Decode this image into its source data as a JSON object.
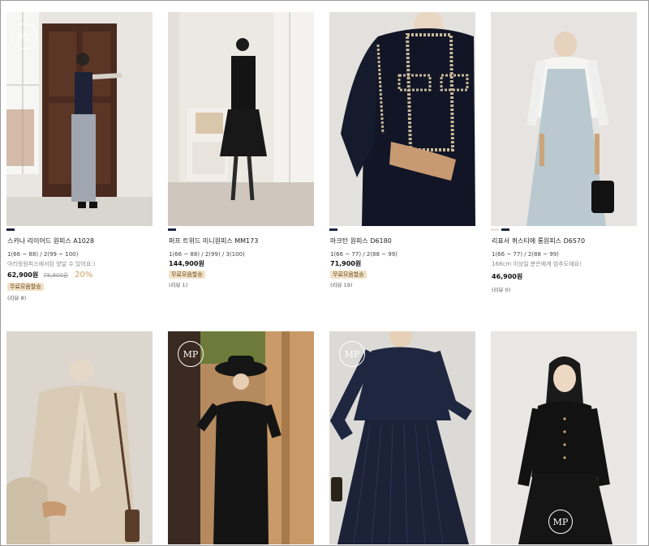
{
  "products": [
    {
      "name": "스카나 리이어드 원피스 A1028",
      "sizes": "1(66 ~ 88) / 2(99 ~ 100)",
      "note": "아리랑원피스에서된 양날 수 있어요:)",
      "price": "62,900원",
      "original_price": "78,900원",
      "discount": "20%",
      "badge": "무료모음할승",
      "review": "(리뷰 8)"
    },
    {
      "name": "퍼프 트위드 미니원피스 MM173",
      "sizes": "1(66 ~ 88) / 2(99) / 3(100)",
      "note": "",
      "price": "144,900원",
      "original_price": "",
      "discount": "",
      "badge": "무료모음할승",
      "review": "(리뷰 1)"
    },
    {
      "name": "마크턴 원피스 D6180",
      "sizes": "1(66 ~ 77) / 2(88 ~ 99)",
      "note": "",
      "price": "71,900원",
      "original_price": "",
      "discount": "",
      "badge": "무료모음할승",
      "review": "(리뷰 19)"
    },
    {
      "name": "리표서 퀴스티에 롱원피스 D6570",
      "sizes": "1(66 ~ 77) / 2(88 ~ 99)",
      "note": "168cm 이상일 분은에게 엄추도에요!",
      "price": "46,900원",
      "original_price": "",
      "discount": "",
      "badge": "",
      "review": "(리뷰 0)"
    }
  ],
  "logo_text": "MP",
  "colors": {
    "swatch_navy": "#1e2540",
    "discount": "#c9a06a",
    "badge_bg": "#f1e2c6"
  }
}
